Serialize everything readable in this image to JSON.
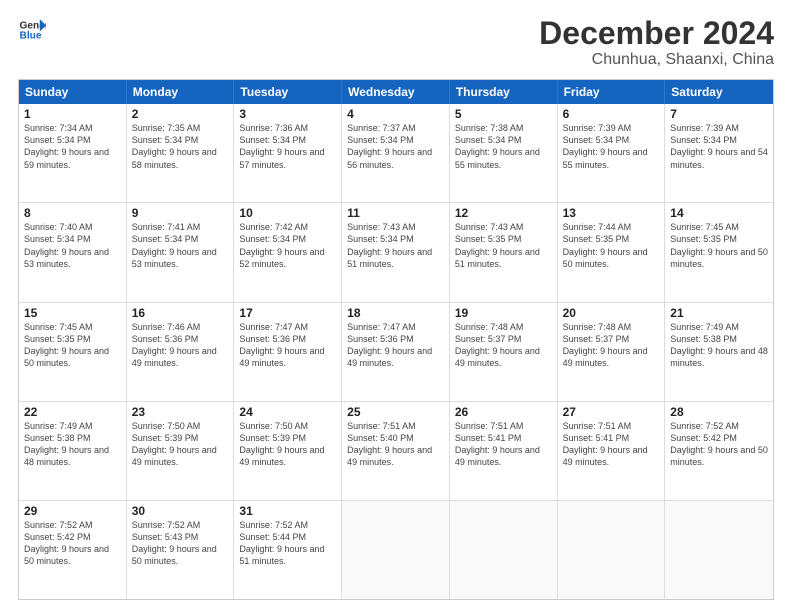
{
  "logo": {
    "line1": "General",
    "line2": "Blue"
  },
  "title": "December 2024",
  "subtitle": "Chunhua, Shaanxi, China",
  "days_of_week": [
    "Sunday",
    "Monday",
    "Tuesday",
    "Wednesday",
    "Thursday",
    "Friday",
    "Saturday"
  ],
  "weeks": [
    [
      {
        "num": "1",
        "rise": "7:34 AM",
        "set": "5:34 PM",
        "daylight": "9 hours and 59 minutes."
      },
      {
        "num": "2",
        "rise": "7:35 AM",
        "set": "5:34 PM",
        "daylight": "9 hours and 58 minutes."
      },
      {
        "num": "3",
        "rise": "7:36 AM",
        "set": "5:34 PM",
        "daylight": "9 hours and 57 minutes."
      },
      {
        "num": "4",
        "rise": "7:37 AM",
        "set": "5:34 PM",
        "daylight": "9 hours and 56 minutes."
      },
      {
        "num": "5",
        "rise": "7:38 AM",
        "set": "5:34 PM",
        "daylight": "9 hours and 55 minutes."
      },
      {
        "num": "6",
        "rise": "7:39 AM",
        "set": "5:34 PM",
        "daylight": "9 hours and 55 minutes."
      },
      {
        "num": "7",
        "rise": "7:39 AM",
        "set": "5:34 PM",
        "daylight": "9 hours and 54 minutes."
      }
    ],
    [
      {
        "num": "8",
        "rise": "7:40 AM",
        "set": "5:34 PM",
        "daylight": "9 hours and 53 minutes."
      },
      {
        "num": "9",
        "rise": "7:41 AM",
        "set": "5:34 PM",
        "daylight": "9 hours and 53 minutes."
      },
      {
        "num": "10",
        "rise": "7:42 AM",
        "set": "5:34 PM",
        "daylight": "9 hours and 52 minutes."
      },
      {
        "num": "11",
        "rise": "7:43 AM",
        "set": "5:34 PM",
        "daylight": "9 hours and 51 minutes."
      },
      {
        "num": "12",
        "rise": "7:43 AM",
        "set": "5:35 PM",
        "daylight": "9 hours and 51 minutes."
      },
      {
        "num": "13",
        "rise": "7:44 AM",
        "set": "5:35 PM",
        "daylight": "9 hours and 50 minutes."
      },
      {
        "num": "14",
        "rise": "7:45 AM",
        "set": "5:35 PM",
        "daylight": "9 hours and 50 minutes."
      }
    ],
    [
      {
        "num": "15",
        "rise": "7:45 AM",
        "set": "5:35 PM",
        "daylight": "9 hours and 50 minutes."
      },
      {
        "num": "16",
        "rise": "7:46 AM",
        "set": "5:36 PM",
        "daylight": "9 hours and 49 minutes."
      },
      {
        "num": "17",
        "rise": "7:47 AM",
        "set": "5:36 PM",
        "daylight": "9 hours and 49 minutes."
      },
      {
        "num": "18",
        "rise": "7:47 AM",
        "set": "5:36 PM",
        "daylight": "9 hours and 49 minutes."
      },
      {
        "num": "19",
        "rise": "7:48 AM",
        "set": "5:37 PM",
        "daylight": "9 hours and 49 minutes."
      },
      {
        "num": "20",
        "rise": "7:48 AM",
        "set": "5:37 PM",
        "daylight": "9 hours and 49 minutes."
      },
      {
        "num": "21",
        "rise": "7:49 AM",
        "set": "5:38 PM",
        "daylight": "9 hours and 48 minutes."
      }
    ],
    [
      {
        "num": "22",
        "rise": "7:49 AM",
        "set": "5:38 PM",
        "daylight": "9 hours and 48 minutes."
      },
      {
        "num": "23",
        "rise": "7:50 AM",
        "set": "5:39 PM",
        "daylight": "9 hours and 49 minutes."
      },
      {
        "num": "24",
        "rise": "7:50 AM",
        "set": "5:39 PM",
        "daylight": "9 hours and 49 minutes."
      },
      {
        "num": "25",
        "rise": "7:51 AM",
        "set": "5:40 PM",
        "daylight": "9 hours and 49 minutes."
      },
      {
        "num": "26",
        "rise": "7:51 AM",
        "set": "5:41 PM",
        "daylight": "9 hours and 49 minutes."
      },
      {
        "num": "27",
        "rise": "7:51 AM",
        "set": "5:41 PM",
        "daylight": "9 hours and 49 minutes."
      },
      {
        "num": "28",
        "rise": "7:52 AM",
        "set": "5:42 PM",
        "daylight": "9 hours and 50 minutes."
      }
    ],
    [
      {
        "num": "29",
        "rise": "7:52 AM",
        "set": "5:42 PM",
        "daylight": "9 hours and 50 minutes."
      },
      {
        "num": "30",
        "rise": "7:52 AM",
        "set": "5:43 PM",
        "daylight": "9 hours and 50 minutes."
      },
      {
        "num": "31",
        "rise": "7:52 AM",
        "set": "5:44 PM",
        "daylight": "9 hours and 51 minutes."
      },
      null,
      null,
      null,
      null
    ]
  ]
}
